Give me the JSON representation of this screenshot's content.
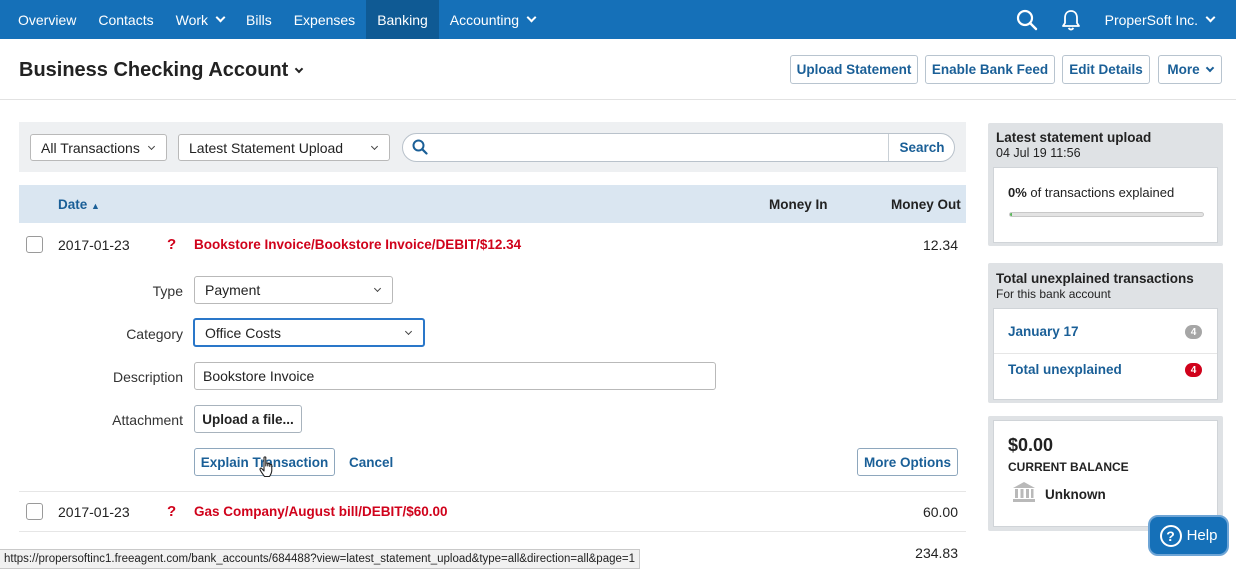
{
  "nav": {
    "items": [
      {
        "label": "Overview",
        "dropdown": false,
        "active": false
      },
      {
        "label": "Contacts",
        "dropdown": false,
        "active": false
      },
      {
        "label": "Work",
        "dropdown": true,
        "active": false
      },
      {
        "label": "Bills",
        "dropdown": false,
        "active": false
      },
      {
        "label": "Expenses",
        "dropdown": false,
        "active": false
      },
      {
        "label": "Banking",
        "dropdown": false,
        "active": true
      },
      {
        "label": "Accounting",
        "dropdown": true,
        "active": false
      }
    ],
    "company": "ProperSoft Inc.",
    "icons": [
      "search-icon",
      "bell-icon"
    ]
  },
  "header": {
    "title": "Business Checking Account",
    "buttons": {
      "upload": "Upload Statement",
      "bank_feed": "Enable Bank Feed",
      "edit": "Edit Details",
      "more": "More"
    }
  },
  "filters": {
    "type_filter": "All Transactions",
    "upload_filter": "Latest Statement Upload",
    "search_placeholder": "",
    "search_button": "Search"
  },
  "table": {
    "columns": {
      "date": "Date",
      "money_in": "Money In",
      "money_out": "Money Out"
    },
    "sort": "ascending",
    "rows": [
      {
        "date": "2017-01-23",
        "status": "?",
        "description": "Bookstore Invoice/Bookstore Invoice/DEBIT/$12.34",
        "money_out": "12.34"
      },
      {
        "date": "2017-01-23",
        "status": "?",
        "description": "Gas Company/August bill/DEBIT/$60.00",
        "money_out": "60.00"
      },
      {
        "money_out": "234.83"
      }
    ]
  },
  "explain_form": {
    "type_label": "Type",
    "type_value": "Payment",
    "category_label": "Category",
    "category_value": "Office Costs",
    "description_label": "Description",
    "description_value": "Bookstore Invoice",
    "attachment_label": "Attachment",
    "upload_button": "Upload a file...",
    "explain_button": "Explain Transaction",
    "cancel_link": "Cancel",
    "more_options_button": "More Options"
  },
  "sidebar": {
    "statement": {
      "title": "Latest statement upload",
      "timestamp": "04 Jul 19 11:56",
      "percent": "0%",
      "percent_text": "of transactions explained",
      "progress_fraction": 0.01
    },
    "unexplained": {
      "title": "Total unexplained transactions",
      "subtitle": "For this bank account",
      "items": [
        {
          "label": "January 17",
          "count": "4",
          "badge_color": "#a6a6a6"
        },
        {
          "label": "Total unexplained",
          "count": "4",
          "badge_color": "#d0021b"
        }
      ]
    },
    "balance": {
      "amount": "$0.00",
      "label": "CURRENT BALANCE",
      "bank": "Unknown"
    }
  },
  "help": {
    "label": "Help"
  },
  "status_url": "https://propersoftinc1.freeagent.com/bank_accounts/684488?view=latest_statement_upload&type=all&direction=all&page=1",
  "colors": {
    "nav": "#1570b8",
    "accent": "#1a5f97",
    "alert": "#d0021b"
  }
}
